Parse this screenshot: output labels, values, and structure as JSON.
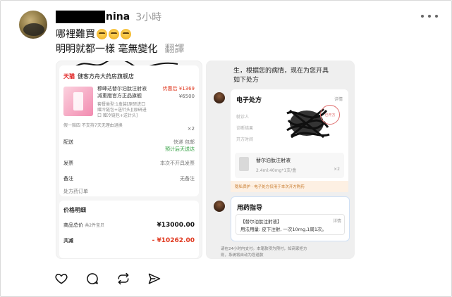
{
  "post": {
    "username_visible": "nina",
    "time": "3小時",
    "line1": "哪裡難買",
    "line2": "明明就都一樣 毫無變化",
    "translate_label": "翻譯"
  },
  "left_screenshot": {
    "store": "健客方舟大药房旗舰店",
    "store_badge": "天猫",
    "product_line1": "穆峰达替尔泊肽注射液",
    "product_line2": "减重版官方正品旗舰",
    "product_line3": "套餐类型:1盒装[原研进口",
    "product_line4": "赠冷链包+送针头][原研进",
    "product_line5": "口 赠冷链包+送针头]",
    "product_note": "假一赔四 不支持7天无理由退换",
    "price_discount": "优惠后 ¥1369",
    "price_original": "¥6500",
    "qty": "×2",
    "shipping_label": "配送",
    "shipping_value": "快递 包邮",
    "shipping_eta": "预计后天送达",
    "invoice_label": "发票",
    "invoice_value": "本次不开具发票",
    "remark_label": "备注",
    "remark_value": "无备注",
    "rx_order": "处方药订单",
    "price_detail_title": "价格明细",
    "total_label": "商品总价",
    "total_note": "共2件宝贝",
    "total_value": "¥13000.00",
    "discount_label": "共减",
    "discount_value": "- ¥10262.00"
  },
  "right_screenshot": {
    "top_text1": "生，根据您的病情，现在为您开具",
    "top_text2": "如下处方",
    "rx_title": "电子处方",
    "rx_detail": "详情",
    "field_patient": "就诊人",
    "field_diagnosis": "诊断结果",
    "field_time": "开方时间",
    "stamp": "已开方",
    "drug": "替尔泊肽注射液",
    "dose": "2.4ml:40mg*1支/盒",
    "dose_qty": "×2",
    "notice": "隐私保护 · 电子处方仅用于本次开方购药",
    "guide_title": "用药指导",
    "guide_detail": "详情",
    "guide_drug": "【替尔泊肽注射液】",
    "guide_usage": "用法用量: 皮下注射, 一次10mg,1周1次。",
    "bottom_text1": "请在24小时内支付。本笔款项为预付，如商家拒方",
    "bottom_text2": "则，系统将自动为您退款"
  },
  "actions": {
    "like": "like-icon",
    "comment": "comment-icon",
    "repost": "repost-icon",
    "share": "share-icon"
  }
}
